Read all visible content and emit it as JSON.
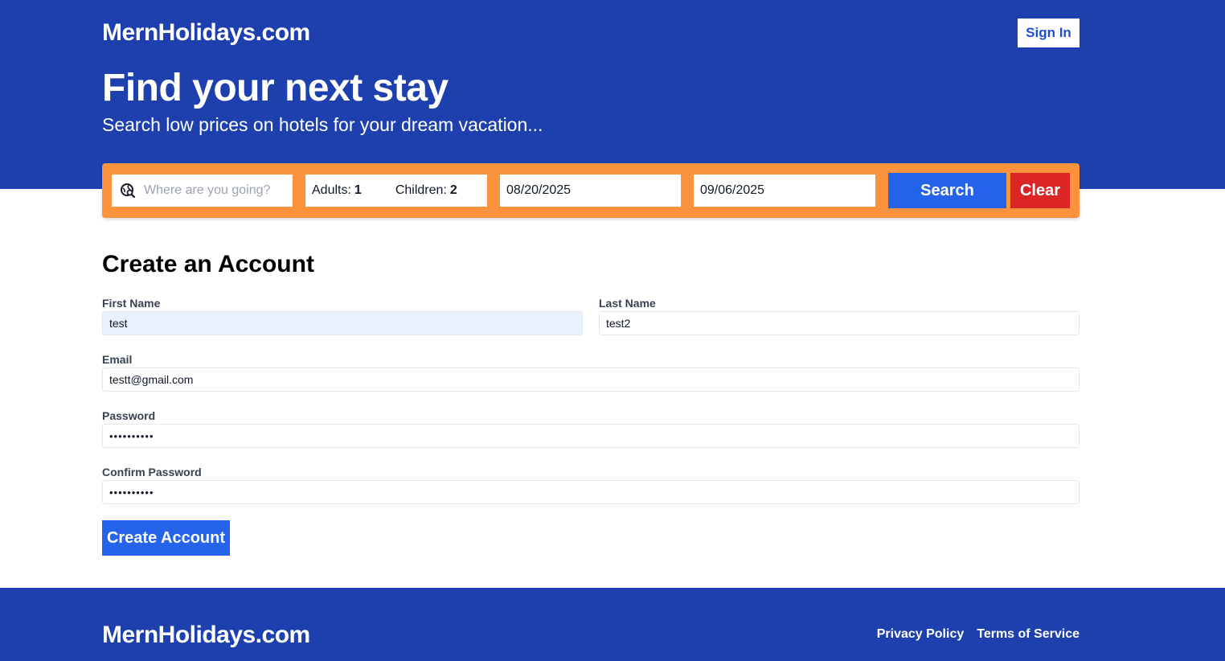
{
  "header": {
    "brand": "MernHolidays.com",
    "sign_in_label": "Sign In",
    "hero_title": "Find your next stay",
    "hero_subtitle": "Search low prices on hotels for your dream vacation..."
  },
  "search_bar": {
    "destination_placeholder": "Where are you going?",
    "destination_value": "",
    "destination_icon": "globe-search-icon",
    "adults_label": "Adults:",
    "adults_value": "1",
    "children_label": "Children:",
    "children_value": "2",
    "check_in": "08/20/2025",
    "check_out": "09/06/2025",
    "search_label": "Search",
    "clear_label": "Clear"
  },
  "form": {
    "title": "Create an Account",
    "first_name_label": "First Name",
    "first_name_value": "test",
    "last_name_label": "Last Name",
    "last_name_value": "test2",
    "email_label": "Email",
    "email_value": "testt@gmail.com",
    "password_label": "Password",
    "password_mask": "••••••••••",
    "confirm_password_label": "Confirm Password",
    "confirm_password_mask": "••••••••••",
    "submit_label": "Create Account"
  },
  "footer": {
    "brand": "MernHolidays.com",
    "links": [
      "Privacy Policy",
      "Terms of Service"
    ]
  },
  "colors": {
    "primary_blue": "#1e40af",
    "button_blue": "#2563eb",
    "search_bar_orange": "#fb923c",
    "clear_red": "#dc2626",
    "autofill_bg": "#e8f0fe"
  }
}
